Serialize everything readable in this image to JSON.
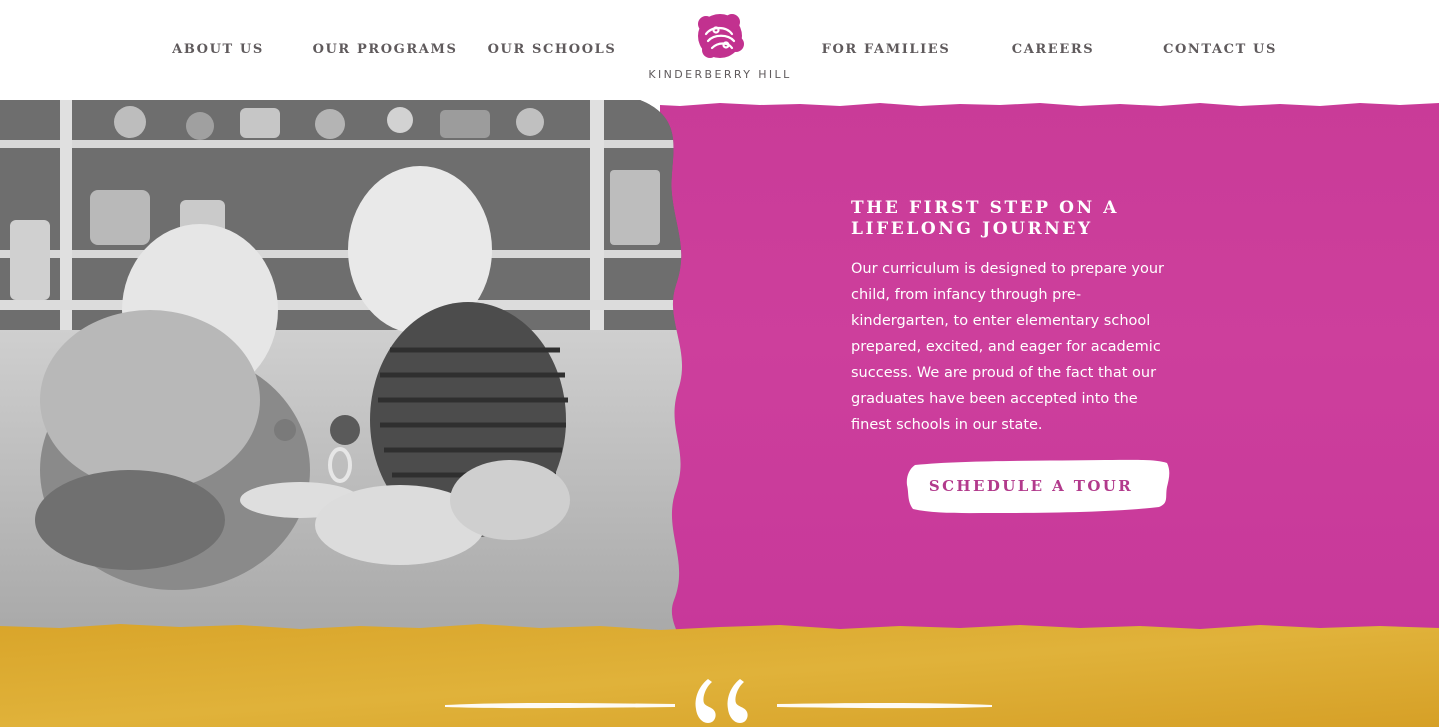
{
  "nav": {
    "items": [
      {
        "label": "ABOUT US"
      },
      {
        "label": "OUR PROGRAMS"
      },
      {
        "label": "OUR SCHOOLS"
      },
      {
        "label": "FOR FAMILIES"
      },
      {
        "label": "CAREERS"
      },
      {
        "label": "CONTACT US"
      }
    ]
  },
  "logo": {
    "text": "KINDERBERRY HILL",
    "icon": "berry-logo-icon"
  },
  "hero": {
    "title": "THE FIRST STEP ON A LIFELONG JOURNEY",
    "body": "Our curriculum is designed to prepare your child, from infancy through pre-kindergarten, to enter elementary school prepared, excited, and eager for academic success. We are proud of the fact that our graduates have been accepted into the finest schools in our state.",
    "cta_label": "SCHEDULE A TOUR",
    "image": "black-and-white photo of two babies playing with toys on a carpet"
  },
  "testimonial": {
    "icon": "quote-icon"
  },
  "colors": {
    "magenta": "#c93b98",
    "yellow": "#dcaa2e",
    "nav_text": "#5f5a5c",
    "cta_text": "#b23a8c"
  }
}
